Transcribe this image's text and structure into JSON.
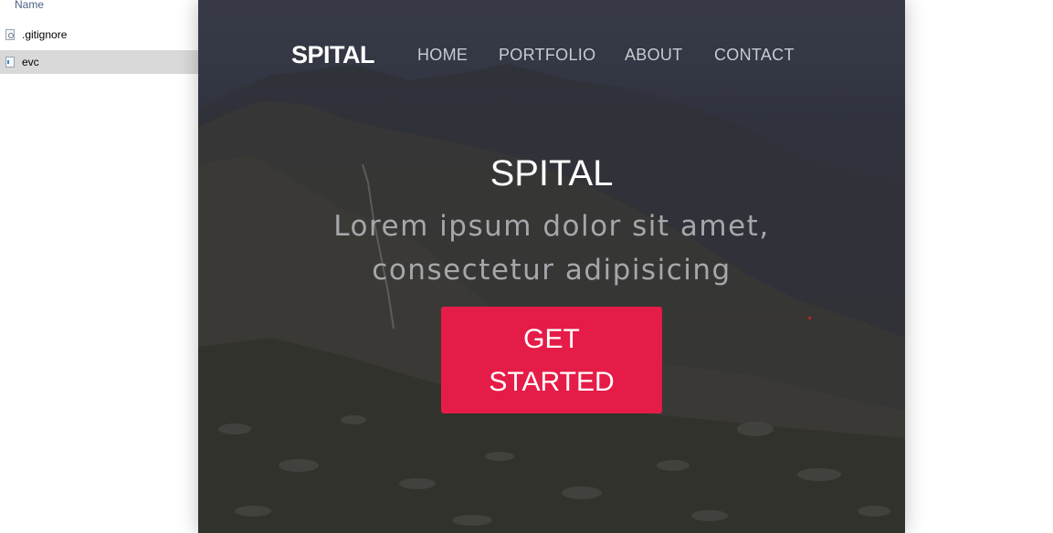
{
  "explorer": {
    "header": "Name",
    "files": [
      {
        "name": ".gitignore",
        "icon": "settings-file-icon",
        "selected": false
      },
      {
        "name": "evc",
        "icon": "code-file-icon",
        "selected": true
      }
    ]
  },
  "site": {
    "brand": "SPITAL",
    "nav": [
      "HOME",
      "PORTFOLIO",
      "ABOUT",
      "CONTACT"
    ],
    "hero": {
      "title": "SPITAL",
      "subtitle": "Lorem ipsum dolor sit amet, consectetur adipisicing",
      "cta": "GET STARTED"
    },
    "colors": {
      "cta": "#e61c48",
      "nav_text": "#c9cbd1",
      "subtitle_text": "#a6a7aa"
    }
  }
}
